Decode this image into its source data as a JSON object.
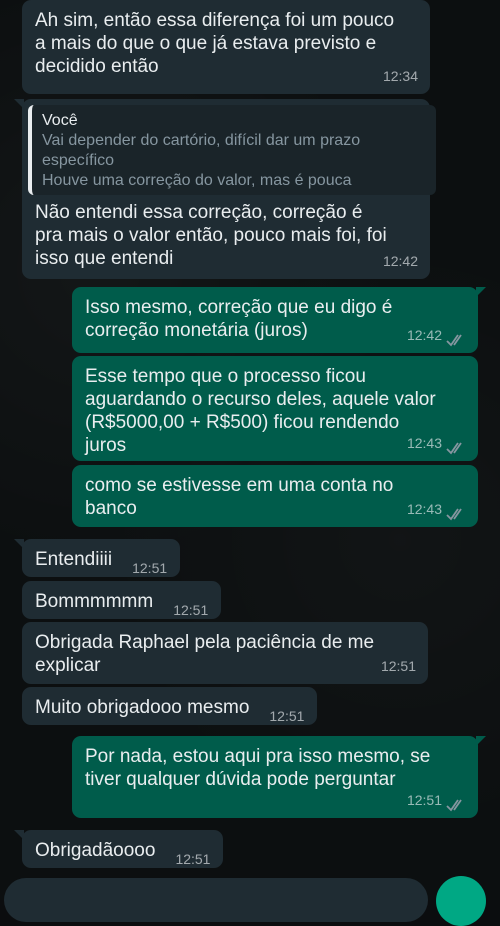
{
  "messages": [
    {
      "text": "Ah sim, então essa diferença foi um pouco\na mais do que o que já estava previsto e\ndecidido então",
      "time": "12:34"
    },
    {
      "quote_author": "Você",
      "quote_text": "Vai depender do cartório, difícil dar um prazo\nespecífico\nHouve uma correção do valor, mas é pouca",
      "text": "Não entendi essa correção, correção é\npra mais o valor então, pouco mais foi, foi\nisso que entendi",
      "time": "12:42"
    },
    {
      "text": "Isso  mesmo, correção que eu digo  é\ncorreção monetária (juros)",
      "time": "12:42"
    },
    {
      "text": "Esse tempo que o processo ficou\naguardando o recurso deles, aquele valor\n(R$5000,00 + R$500) ficou rendendo\njuros",
      "time": "12:43"
    },
    {
      "text": "como se estivesse em uma conta no\nbanco",
      "time": "12:43"
    },
    {
      "text": "Entendiiii",
      "time": "12:51"
    },
    {
      "text": "Bommmmmm",
      "time": "12:51"
    },
    {
      "text": "Obrigada Raphael pela paciência de me\nexplicar",
      "time": "12:51"
    },
    {
      "text": "Muito obrigadooo mesmo",
      "time": "12:51"
    },
    {
      "text": "Por nada, estou aqui pra isso mesmo, se\ntiver qualquer dúvida pode perguntar",
      "time": "12:51"
    },
    {
      "text": "Obrigadãoooo",
      "time": "12:51"
    }
  ],
  "icons": {
    "read_receipt": "double-check-icon",
    "send": "mic-icon"
  },
  "colors": {
    "incoming": "#1f2c33",
    "outgoing": "#005c4b",
    "read_tick": "#8696a0",
    "send_button": "#00a884"
  }
}
